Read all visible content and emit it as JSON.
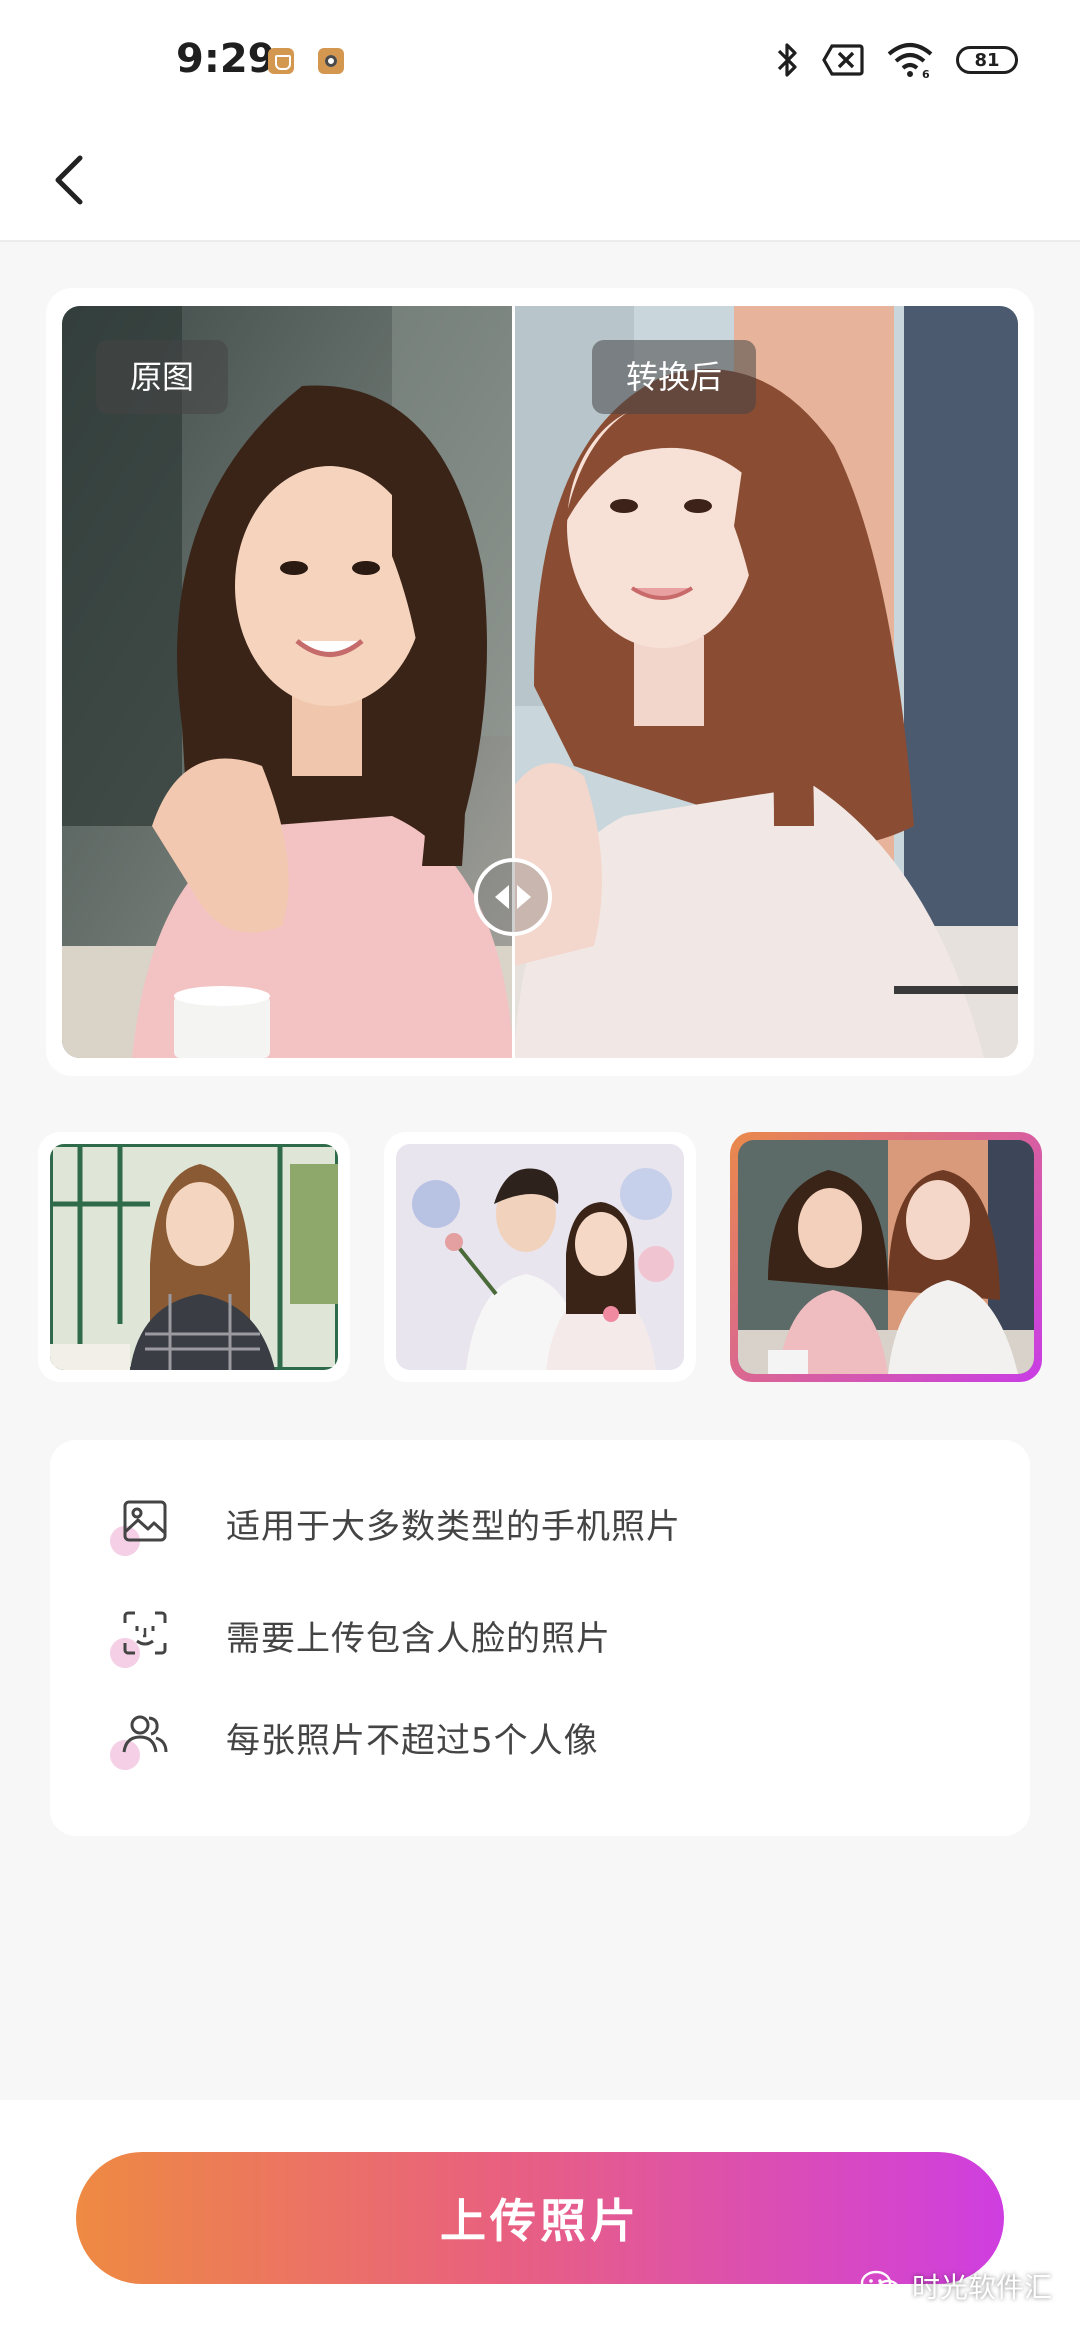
{
  "status_bar": {
    "time": "9:29",
    "battery": "81",
    "notification_icons": [
      "shield-app-icon",
      "camera-app-icon"
    ],
    "system_icons": [
      "bluetooth-icon",
      "sim-off-icon",
      "wifi-icon",
      "battery-icon"
    ]
  },
  "header": {
    "back_icon": "chevron-left-icon"
  },
  "compare": {
    "original_label": "原图",
    "converted_label": "转换后",
    "slider_icon": "left-right-arrows-icon"
  },
  "samples": {
    "items": [
      {
        "name": "sample-girl-window",
        "selected": false
      },
      {
        "name": "sample-couple-flowers",
        "selected": false
      },
      {
        "name": "sample-two-girls",
        "selected": true
      }
    ],
    "selected_border_colors": [
      "#e98a4a",
      "#c93ce6"
    ]
  },
  "tips": [
    {
      "icon": "image-icon",
      "text": "适用于大多数类型的手机照片"
    },
    {
      "icon": "face-scan-icon",
      "text": "需要上传包含人脸的照片"
    },
    {
      "icon": "users-icon",
      "text": "每张照片不超过5个人像"
    }
  ],
  "upload": {
    "label": "上传照片",
    "gradient": [
      "#ee8a42",
      "#e9617e",
      "#cf3ee0"
    ]
  },
  "watermark": {
    "text": "时光软件汇",
    "icon": "wechat-icon"
  }
}
